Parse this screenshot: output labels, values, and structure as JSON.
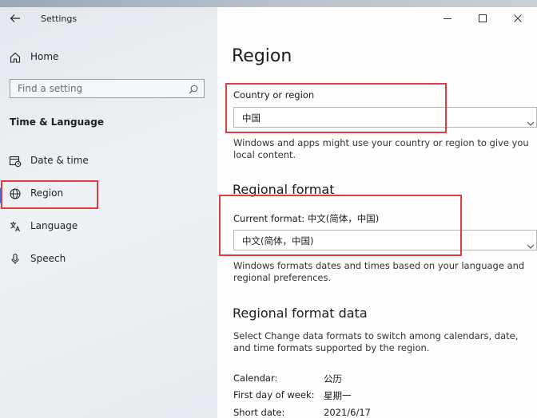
{
  "window": {
    "title": "Settings"
  },
  "sidebar": {
    "home_label": "Home",
    "search_placeholder": "Find a setting",
    "section_title": "Time & Language",
    "items": [
      {
        "label": "Date & time",
        "icon": "calendar-clock-icon"
      },
      {
        "label": "Region",
        "icon": "globe-icon",
        "selected": true
      },
      {
        "label": "Language",
        "icon": "language-icon"
      },
      {
        "label": "Speech",
        "icon": "microphone-icon"
      }
    ]
  },
  "main": {
    "page_title": "Region",
    "country": {
      "label": "Country or region",
      "value": "中国",
      "description": "Windows and apps might use your country or region to give you local content."
    },
    "regional_format": {
      "title": "Regional format",
      "current_label": "Current format: 中文(简体，中国)",
      "value": "中文(简体，中国)",
      "description": "Windows formats dates and times based on your language and regional preferences."
    },
    "format_data": {
      "title": "Regional format data",
      "description": "Select Change data formats to switch among calendars, date, and time formats supported by the region.",
      "rows": [
        {
          "key": "Calendar:",
          "value": "公历"
        },
        {
          "key": "First day of week:",
          "value": "星期一"
        },
        {
          "key": "Short date:",
          "value": "2021/6/17"
        }
      ]
    }
  },
  "colors": {
    "accent": "#2f6fd6",
    "highlight": "#e23b40"
  }
}
